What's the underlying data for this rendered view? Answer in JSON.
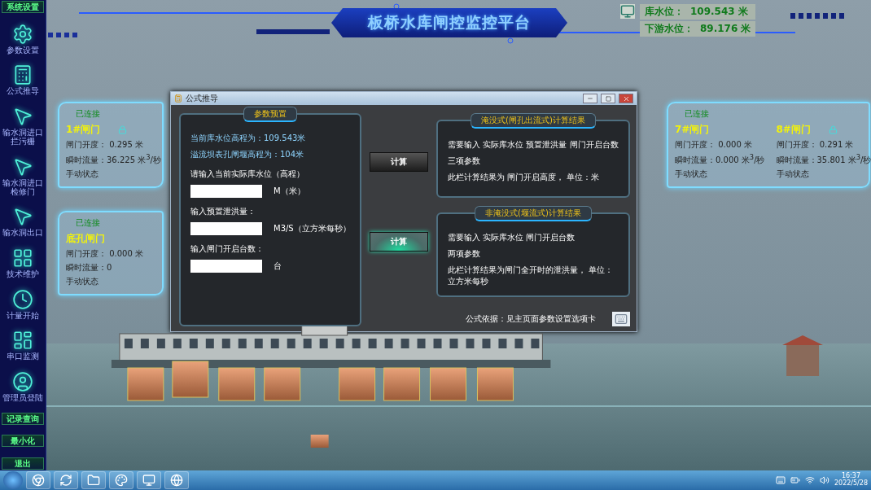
{
  "sidebar": {
    "top_button": "系统设置",
    "items": [
      {
        "label": "参数设置",
        "kind": "gear"
      },
      {
        "label": "公式推导",
        "kind": "calculator"
      },
      {
        "label": "输水洞进口拦污栅",
        "kind": "pointer"
      },
      {
        "label": "输水洞进口检修门",
        "kind": "pointer"
      },
      {
        "label": "输水洞出口",
        "kind": "pointer"
      },
      {
        "label": "技术维护",
        "kind": "grid"
      },
      {
        "label": "计量开始",
        "kind": "clock"
      },
      {
        "label": "串口监测",
        "kind": "layout"
      },
      {
        "label": "管理员登陆",
        "kind": "user"
      }
    ],
    "bottom_buttons": [
      "记录查询",
      "最小化",
      "退出"
    ]
  },
  "header": {
    "title": "板桥水库闸控监控平台",
    "levels": [
      {
        "label": "库水位：",
        "value": "109.543 米"
      },
      {
        "label": "下游水位：",
        "value": "89.176 米"
      }
    ]
  },
  "left_cards": [
    {
      "status": "已连接",
      "gates": [
        {
          "name": "1#闸门",
          "lock": true,
          "opening": "闸门开度： 0.295 米",
          "flow": "瞬时流量：36.225 米$^{3}$/秒",
          "mode": "手动状态"
        }
      ]
    },
    {
      "status": "已连接",
      "gates": [
        {
          "name": "底孔闸门",
          "lock": false,
          "opening": "闸门开度： 0.000 米",
          "flow": "瞬时流量：0",
          "mode": "手动状态"
        }
      ]
    }
  ],
  "right_cards": [
    {
      "status": "已连接",
      "gates": [
        {
          "name": "7#闸门",
          "lock": false,
          "opening": "闸门开度： 0.000 米",
          "flow": "瞬时流量：0.000 米$^{3}$/秒",
          "mode": "手动状态"
        },
        {
          "name": "8#闸门",
          "lock": true,
          "opening": "闸门开度： 0.291 米",
          "flow": "瞬时流量：35.801 米$^{3}$/秒",
          "mode": "手动状态"
        }
      ]
    }
  ],
  "dialog": {
    "title": "公式推导",
    "preset": {
      "title": "参数预置",
      "info": [
        "当前库水位高程为：109.543米",
        "溢流坝表孔闸堰高程为：104米"
      ],
      "fields": [
        {
          "label": "请输入当前实际库水位（高程）",
          "unit": "M（米）"
        },
        {
          "label": "输入预置泄洪量：",
          "unit": "M3/S（立方米每秒）"
        },
        {
          "label": "输入闸门开启台数：",
          "unit": "台"
        }
      ]
    },
    "buttons": [
      {
        "label": "计算",
        "highlighted": false
      },
      {
        "label": "计算",
        "highlighted": true
      }
    ],
    "results": [
      {
        "title": "淹没式(闸孔出流式)计算结果",
        "lines": [
          "需要输入 实际库水位 预置泄洪量 闸门开启台数",
          "三项参数",
          "此栏计算结果为 闸门开启高度， 单位：米"
        ]
      },
      {
        "title": "非淹没式(堰流式)计算结果",
        "lines": [
          "需要输入 实际库水位 闸门开启台数",
          "两项参数",
          "此栏计算结果为闸门全开时的泄洪量， 单位：立方米每秒"
        ]
      }
    ],
    "footer": "公式依据：见主页面参数设置选项卡"
  },
  "taskbar": {
    "time": "16:37",
    "date": "2022/5/28"
  }
}
